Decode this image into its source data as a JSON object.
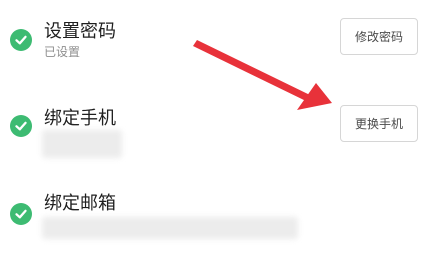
{
  "colors": {
    "check_green": "#3dbb72",
    "arrow_red": "#e8323a"
  },
  "rows": [
    {
      "title": "设置密码",
      "subtitle": "已设置",
      "button": "修改密码",
      "icon": "check-circle-icon"
    },
    {
      "title": "绑定手机",
      "button": "更换手机",
      "icon": "check-circle-icon"
    },
    {
      "title": "绑定邮箱",
      "icon": "check-circle-icon"
    }
  ]
}
